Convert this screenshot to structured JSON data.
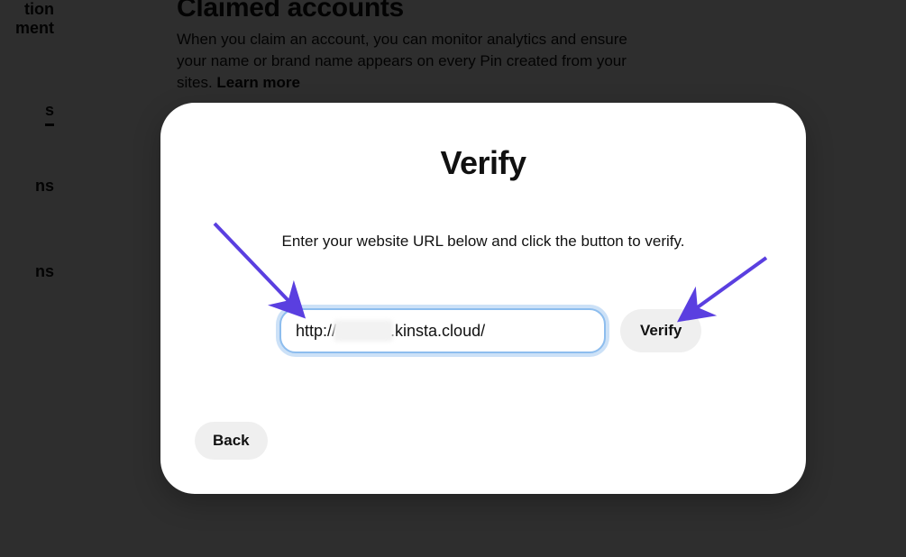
{
  "sidebar": {
    "items": [
      "tion",
      "ment"
    ],
    "current": "s",
    "after": [
      "ns",
      "ns"
    ]
  },
  "header": {
    "title": "Claimed accounts",
    "description": "When you claim an account, you can monitor analytics and ensure your name or brand name appears on every Pin created from your sites. ",
    "learn_more": "Learn more"
  },
  "modal": {
    "title": "Verify",
    "description": "Enter your website URL below and click the button to verify.",
    "url_value": "http://            .kinsta.cloud/",
    "verify_label": "Verify",
    "back_label": "Back"
  },
  "annotations": {
    "arrow_color": "#5a3fe0"
  }
}
